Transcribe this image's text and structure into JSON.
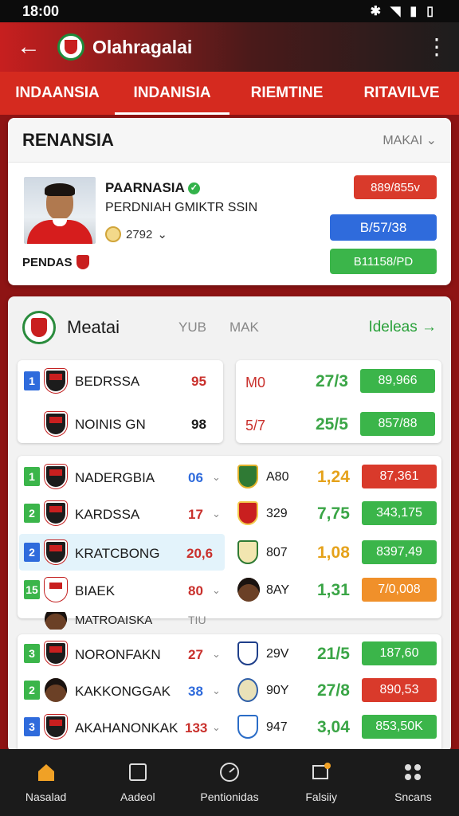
{
  "status": {
    "time": "18:00",
    "icons": [
      "bluetooth-icon",
      "wifi-icon",
      "signal-icon",
      "battery-icon"
    ]
  },
  "appbar": {
    "title": "Olahragalai"
  },
  "tabs": [
    {
      "label": "INDAANSIA"
    },
    {
      "label": "INDANISIA"
    },
    {
      "label": "RIEMTINE"
    },
    {
      "label": "RITAVILVE"
    }
  ],
  "profile": {
    "title": "RENANSIA",
    "more": "MAKAI",
    "name": "PAARNASIA",
    "subtitle": "PERDNIAH GMIKTR SSIN",
    "stat": "2792",
    "club": "PENDAS",
    "pills": {
      "red": "889/855v",
      "blue": "B/57/38",
      "green": "B11158/PD"
    }
  },
  "matches": {
    "title": "Meatai",
    "col1": "YUB",
    "col2": "MAK",
    "link": "Ideleas",
    "top_left": [
      {
        "rank": "1",
        "name": "BEDRSSA",
        "value": "95"
      },
      {
        "rank": "",
        "name": "NOINIS GN",
        "value": "98"
      }
    ],
    "top_right": [
      {
        "label": "M0",
        "odds": "27/3",
        "btn": "89,966"
      },
      {
        "label": "5/7",
        "odds": "25/5",
        "btn": "857/88"
      }
    ],
    "rows": [
      {
        "rank": "1",
        "name": "NADERGBIA",
        "value": "06",
        "opp": "A80",
        "odds": "1,24",
        "btn": "87,361"
      },
      {
        "rank": "2",
        "name": "KARDSSA",
        "value": "17",
        "opp": "329",
        "odds": "7,75",
        "btn": "343,175"
      },
      {
        "rank": "2",
        "name": "KRATCBONG",
        "value": "20,6",
        "opp": "807",
        "odds": "1,08",
        "btn": "8397,49"
      },
      {
        "rank": "15",
        "name": "BIAEK",
        "value": "80",
        "opp": "8AY",
        "odds": "1,31",
        "btn": "7/0,008"
      },
      {
        "rank": "",
        "name": "MATROAISKA",
        "value": "TIU",
        "opp": "",
        "odds": "",
        "btn": ""
      },
      {
        "rank": "3",
        "name": "NORONFAKN",
        "value": "27",
        "opp": "29V",
        "odds": "21/5",
        "btn": "187,60"
      },
      {
        "rank": "2",
        "name": "KAKKONGGAK",
        "value": "38",
        "opp": "90Y",
        "odds": "27/8",
        "btn": "890,53"
      },
      {
        "rank": "3",
        "name": "AKAHANONKAK",
        "value": "133",
        "opp": "947",
        "odds": "3,04",
        "btn": "853,50K"
      }
    ]
  },
  "nav": [
    {
      "label": "Nasalad",
      "icon": "home-icon"
    },
    {
      "label": "Aadeol",
      "icon": "square-icon"
    },
    {
      "label": "Pentionidas",
      "icon": "gauge-icon"
    },
    {
      "label": "Falsiiy",
      "icon": "notification-icon"
    },
    {
      "label": "Sncans",
      "icon": "grid-icon"
    }
  ],
  "colors": {
    "primary_red": "#d52a1f",
    "green": "#3bb54a",
    "blue": "#2f6bdc",
    "orange": "#f0902a"
  }
}
